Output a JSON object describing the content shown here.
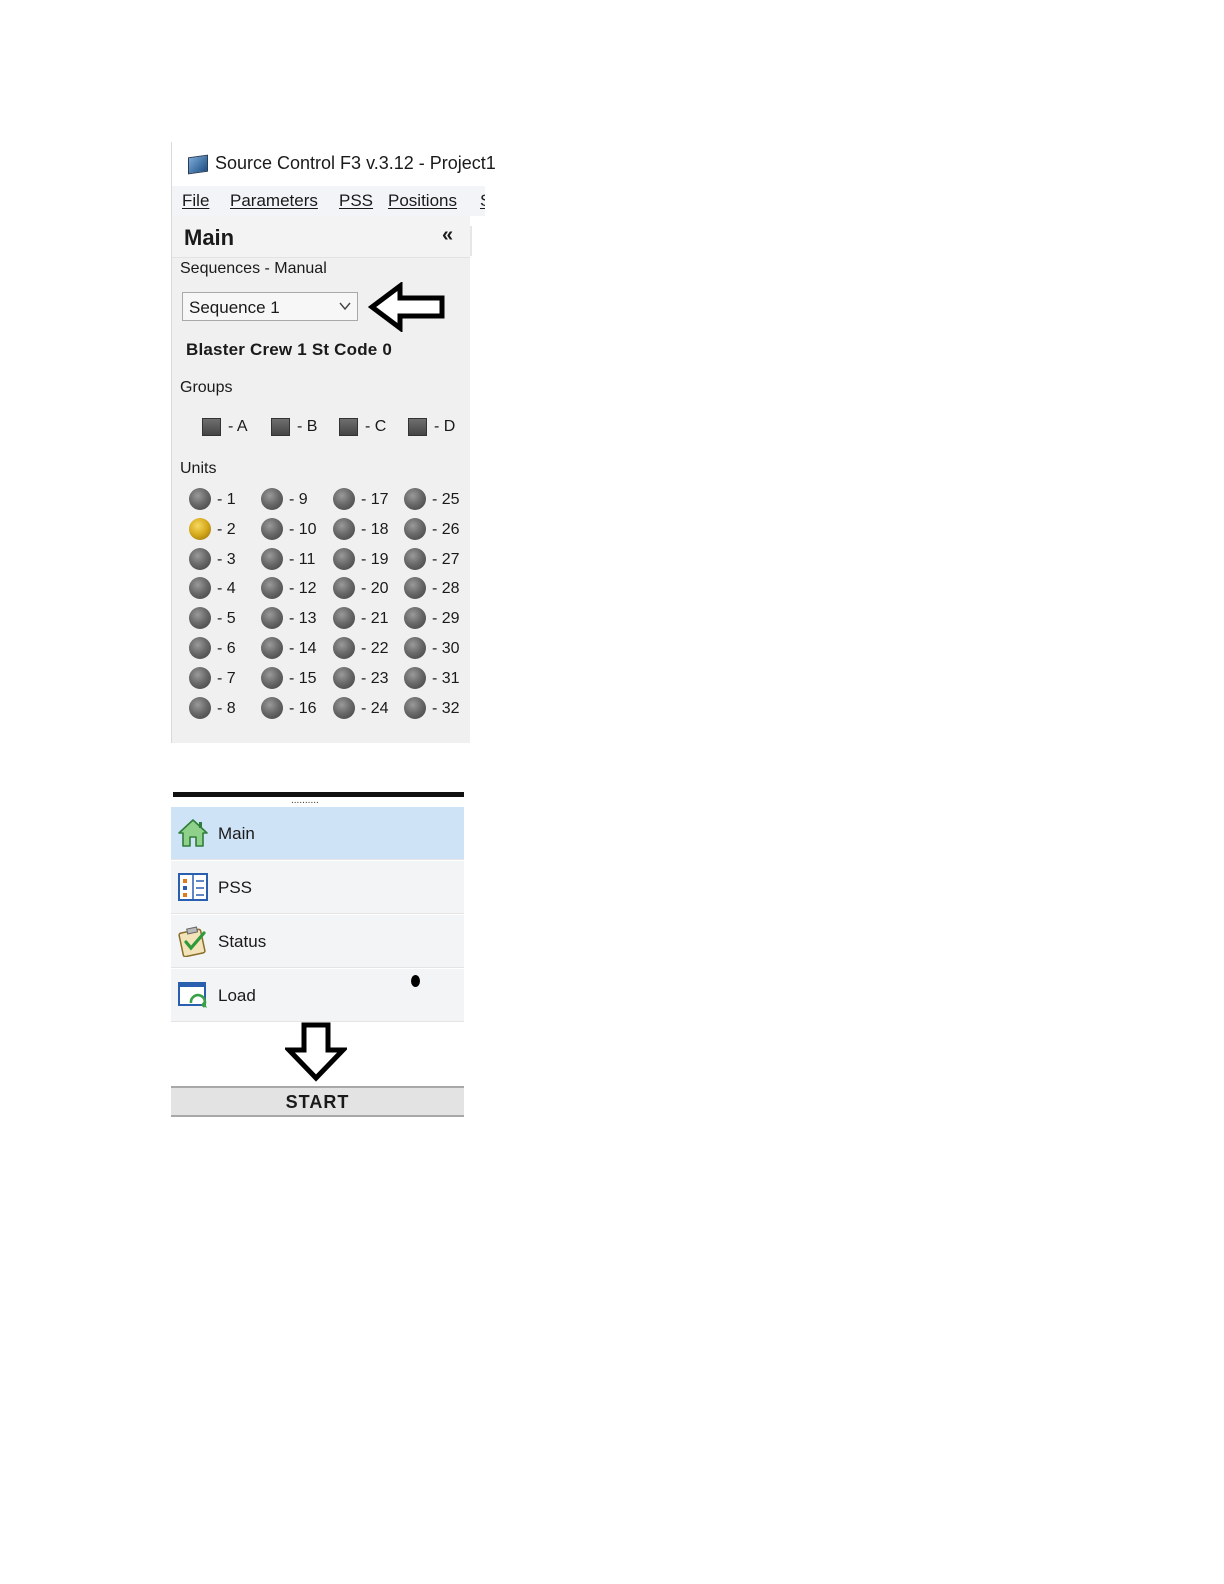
{
  "window": {
    "title": "Source Control F3 v.3.12 - Project1"
  },
  "menu": {
    "items": [
      "File",
      "Parameters",
      "PSS",
      "Positions",
      "S"
    ]
  },
  "panel": {
    "title": "Main",
    "collapse_glyph": "«",
    "sequences_label": "Sequences - Manual",
    "sequence_selected": "Sequence 1",
    "crew_info": "Blaster Crew 1 St Code 0",
    "groups_label": "Groups",
    "groups": [
      "- A",
      "- B",
      "- C",
      "- D"
    ],
    "units_label": "Units",
    "units": [
      {
        "label": "- 1",
        "active": false
      },
      {
        "label": "- 2",
        "active": true
      },
      {
        "label": "- 3",
        "active": false
      },
      {
        "label": "- 4",
        "active": false
      },
      {
        "label": "- 5",
        "active": false
      },
      {
        "label": "- 6",
        "active": false
      },
      {
        "label": "- 7",
        "active": false
      },
      {
        "label": "- 8",
        "active": false
      },
      {
        "label": "- 9",
        "active": false
      },
      {
        "label": "- 10",
        "active": false
      },
      {
        "label": "- 11",
        "active": false
      },
      {
        "label": "- 12",
        "active": false
      },
      {
        "label": "- 13",
        "active": false
      },
      {
        "label": "- 14",
        "active": false
      },
      {
        "label": "- 15",
        "active": false
      },
      {
        "label": "- 16",
        "active": false
      },
      {
        "label": "- 17",
        "active": false
      },
      {
        "label": "- 18",
        "active": false
      },
      {
        "label": "- 19",
        "active": false
      },
      {
        "label": "- 20",
        "active": false
      },
      {
        "label": "- 21",
        "active": false
      },
      {
        "label": "- 22",
        "active": false
      },
      {
        "label": "- 23",
        "active": false
      },
      {
        "label": "- 24",
        "active": false
      },
      {
        "label": "- 25",
        "active": false
      },
      {
        "label": "- 26",
        "active": false
      },
      {
        "label": "- 27",
        "active": false
      },
      {
        "label": "- 28",
        "active": false
      },
      {
        "label": "- 29",
        "active": false
      },
      {
        "label": "- 30",
        "active": false
      },
      {
        "label": "- 31",
        "active": false
      },
      {
        "label": "- 32",
        "active": false
      }
    ]
  },
  "nav": {
    "items": [
      {
        "label": "Main",
        "icon": "home-icon",
        "selected": true
      },
      {
        "label": "PSS",
        "icon": "pss-icon",
        "selected": false
      },
      {
        "label": "Status",
        "icon": "status-clipboard-icon",
        "selected": false
      },
      {
        "label": "Load",
        "icon": "load-refresh-icon",
        "selected": false
      }
    ],
    "grip": "..........",
    "start_label": "START"
  },
  "colors": {
    "selected_nav": "#cfe3f7",
    "unit_active": "#d4a81b",
    "unit_inactive": "#6a6a6a"
  }
}
